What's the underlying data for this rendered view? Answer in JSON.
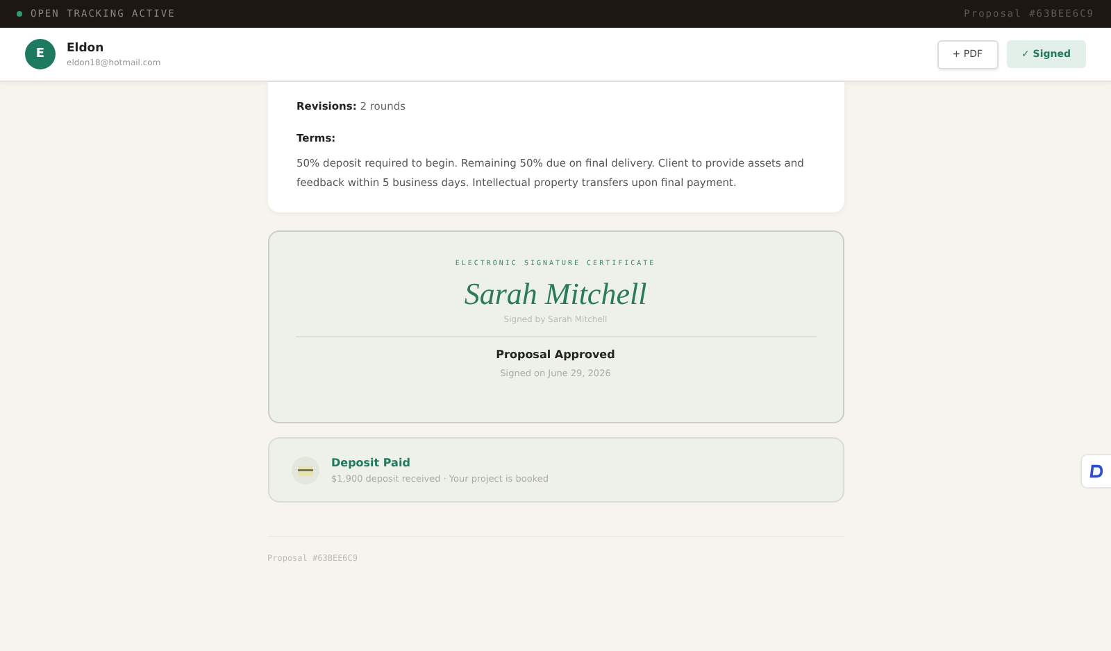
{
  "topbar": {
    "status": "OPEN TRACKING ACTIVE",
    "tracking_on": true,
    "proposal_id": "Proposal #63BEE6C9"
  },
  "header": {
    "avatar": "E",
    "name": "Eldon",
    "email": "eldon18@hotmail.com",
    "buttons": [
      {
        "label": "+ PDF",
        "kind": "outline"
      },
      {
        "label": "✓ Signed",
        "kind": "success"
      }
    ]
  },
  "details": {
    "revisions_label": "Revisions:",
    "revisions_value": "2 rounds",
    "terms_label": "Terms:",
    "terms": "50% deposit required to begin. Remaining 50% due on final delivery. Client to provide assets and feedback within 5 business days. Intellectual property transfers upon final payment."
  },
  "certificate": {
    "heading": "ELECTRONIC SIGNATURE CERTIFICATE",
    "signature": "Sarah Mitchell",
    "signed_by": "Signed by Sarah Mitchell",
    "status": "Proposal Approved",
    "date": "Signed on June 29, 2026"
  },
  "deposit": {
    "title": "Deposit Paid",
    "detail": "$1,900 deposit received · Your project is booked"
  },
  "footer": {
    "proposal_id": "Proposal #63BEE6C9"
  }
}
